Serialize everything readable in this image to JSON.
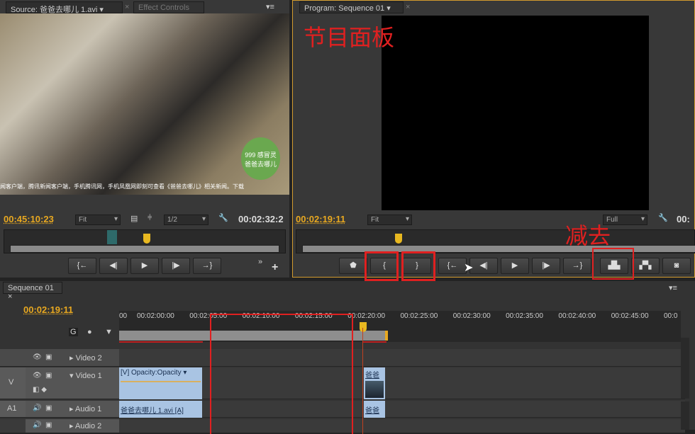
{
  "source_panel": {
    "tab_label": "Source: 爸爸去哪儿 1.avi",
    "tab2_label": "Effect Controls",
    "timecode_in": "00:45:10:23",
    "zoom_select": "Fit",
    "resolution_select": "1/2",
    "duration": "00:02:32:2",
    "buttons": [
      "{←",
      "◀|",
      "▶",
      "|▶",
      "→}"
    ]
  },
  "program_panel": {
    "tab_label": "Program: Sequence 01",
    "timecode": "00:02:19:11",
    "zoom_select": "Fit",
    "resolution_select": "Full",
    "duration": "00:",
    "buttons": [
      "⬟",
      "{",
      "}",
      "{←",
      "◀|",
      "▶",
      "|▶",
      "→}",
      "lift",
      "extract",
      "camera"
    ]
  },
  "annotations": {
    "program_label": "节目面板",
    "lift_label": "减去"
  },
  "timeline": {
    "tab_label": "Sequence 01",
    "timecode": "00:02:19:11",
    "ruler": [
      "00",
      "00:02:00:00",
      "00:02:05:00",
      "00:02:10:00",
      "00:02:15:00",
      "00:02:20:00",
      "00:02:25:00",
      "00:02:30:00",
      "00:02:35:00",
      "00:02:40:00",
      "00:02:45:00",
      "00:0"
    ],
    "tracks": [
      {
        "side": "",
        "name": "Video 2"
      },
      {
        "side": "V",
        "name": "Video 1"
      },
      {
        "side": "A1",
        "name": "Audio 1"
      },
      {
        "side": "",
        "name": "Audio 2"
      }
    ],
    "clips": {
      "video1_a": "[V] Opacity:Opacity",
      "video1_b": "爸爸",
      "audio1_a": "爸爸去哪儿 1.avi [A]",
      "audio1_b": "爸爸"
    }
  },
  "video_overlay": {
    "caption": "闻客户端，腾讯新闻客户端，手机腾讯网，手机凤凰网即刻可查看《爸爸去哪儿》相关新闻。下载",
    "logo": "999 感冒灵 爸爸去哪儿"
  }
}
